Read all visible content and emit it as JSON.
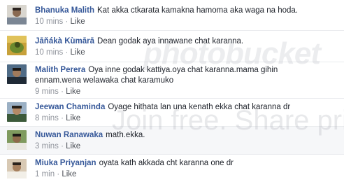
{
  "comments": [
    {
      "author": "Bhanuka Malith",
      "text": "Kat akka ctkarata kamakna hamoma aka waga na hoda.",
      "time": "10 mins",
      "sep": " · ",
      "like": "Like"
    },
    {
      "author": "Jāňákà Kùmārā",
      "text": "Dean godak aya innawane chat karanna.",
      "time": "10 mins",
      "sep": " · ",
      "like": "Like"
    },
    {
      "author": "Malith Perera",
      "text": "Oya inne godak kattiya.oya chat karanna.mama gihin",
      "text2": "ennam.wena welawaka chat karamuko",
      "time": "9 mins",
      "sep": " · ",
      "like": "Like"
    },
    {
      "author": "Jeewan Chaminda",
      "text": "Oyage hithata lan una kenath ekka chat karanna dr",
      "time": "8 mins",
      "sep": " · ",
      "like": "Like"
    },
    {
      "author": "Nuwan Ranawaka",
      "text": "math.ekka.",
      "time": "3 mins",
      "sep": " · ",
      "like": "Like"
    },
    {
      "author": "Miuka Priyanjan",
      "text": "oyata kath akkada cht karanna one dr",
      "time": "1 min",
      "sep": " · ",
      "like": "Like"
    }
  ],
  "watermark": {
    "brand": "photobucket",
    "slogan": "Join free. Share privately."
  },
  "colors": {
    "author": "#365899",
    "text": "#1d2129",
    "meta": "#90949c",
    "divider": "#e9ebee",
    "shaded_row": "#f6f7f9"
  }
}
